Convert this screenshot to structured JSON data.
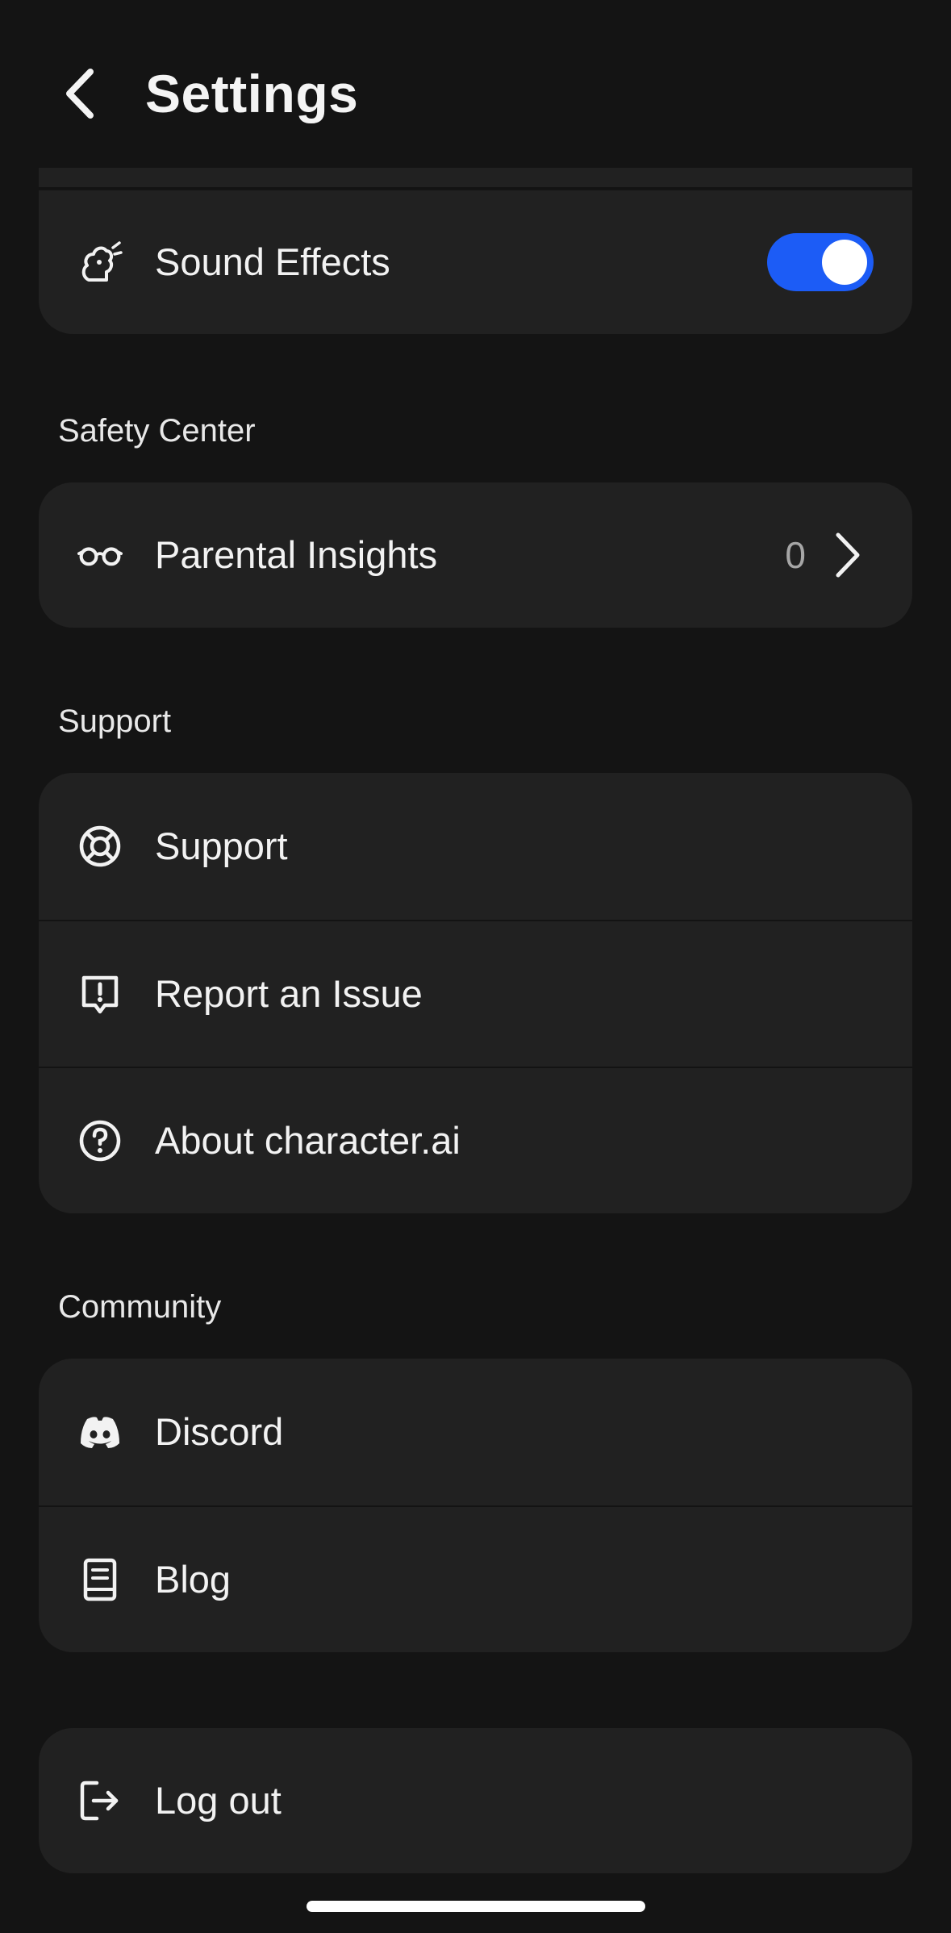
{
  "header": {
    "title": "Settings",
    "back_icon": "chevron-left-icon"
  },
  "preferences": {
    "sound_effects": {
      "label": "Sound Effects",
      "icon": "sound-effects-icon",
      "enabled": true
    }
  },
  "safety_center": {
    "section_label": "Safety Center",
    "parental_insights": {
      "label": "Parental Insights",
      "icon": "glasses-icon",
      "count": "0"
    }
  },
  "support": {
    "section_label": "Support",
    "items": [
      {
        "label": "Support",
        "icon": "lifebuoy-icon"
      },
      {
        "label": "Report an Issue",
        "icon": "report-issue-icon"
      },
      {
        "label": "About character.ai",
        "icon": "help-circle-icon"
      }
    ]
  },
  "community": {
    "section_label": "Community",
    "items": [
      {
        "label": "Discord",
        "icon": "discord-icon"
      },
      {
        "label": "Blog",
        "icon": "book-icon"
      }
    ]
  },
  "logout": {
    "label": "Log out",
    "icon": "logout-icon"
  },
  "colors": {
    "background": "#141414",
    "card": "#212121",
    "accent": "#1c5cf6",
    "text": "#f2f2f2",
    "muted": "#a6a6a6"
  }
}
